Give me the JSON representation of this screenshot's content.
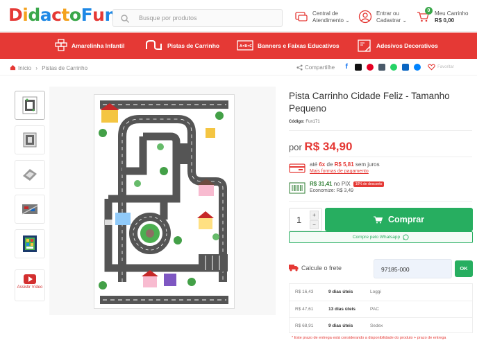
{
  "header": {
    "logo_parts": [
      {
        "text": "D",
        "color": "#e53935"
      },
      {
        "text": "i",
        "color": "#f4a21e"
      },
      {
        "text": "d",
        "color": "#3aa74a"
      },
      {
        "text": "a",
        "color": "#1e88e5"
      },
      {
        "text": "c",
        "color": "#e53935"
      },
      {
        "text": "t",
        "color": "#f4a21e"
      },
      {
        "text": "o",
        "color": "#3aa74a"
      },
      {
        "text": " F",
        "color": "#1e88e5"
      },
      {
        "text": "u",
        "color": "#e53935"
      },
      {
        "text": "n",
        "color": "#1e88e5"
      }
    ],
    "search_placeholder": "Busque por produtos",
    "support_line1": "Central de",
    "support_line2": "Atendimento ⌄",
    "login_line1": "Entrar ou",
    "login_line2": "Cadastrar ⌄",
    "cart_count": "0",
    "cart_line1": "Meu Carrinho",
    "cart_line2": "R$ 0,00"
  },
  "nav": [
    {
      "label": "Amarelinha Infantil",
      "icon": "hopscotch-icon"
    },
    {
      "label": "Pistas de Carrinho",
      "icon": "track-icon"
    },
    {
      "label": "Banners e Faixas Educativos",
      "icon": "banner-icon"
    },
    {
      "label": "Adesivos Decorativos",
      "icon": "sticker-icon"
    }
  ],
  "breadcrumb": {
    "home": "Início",
    "separator": "›",
    "current": "Pistas de Carrinho"
  },
  "share": {
    "label": "Compartilhe",
    "favorite": "Favoritar"
  },
  "product": {
    "title": "Pista Carrinho Cidade Feliz - Tamanho Pequeno",
    "code_label": "Código:",
    "code_value": "Fun171",
    "price_prefix": "por",
    "price": "R$ 34,90",
    "installments_prefix": "até",
    "installments_count": "6x",
    "installments_mid": "de",
    "installments_value": "R$ 5,81",
    "installments_suffix": "sem juros",
    "payment_link": "Mais formas de pagamento",
    "pix_price": "R$ 31,41",
    "pix_suffix": "no PIX",
    "pix_badge": "10% de desconto",
    "pix_savings": "Economize: R$ 3,49",
    "quantity": "1",
    "qty_up": "+",
    "qty_down": "−",
    "buy_label": "Comprar",
    "whatsapp_label": "Compre pelo Whatsapp"
  },
  "video_label": "Assistir Vídeo",
  "shipping": {
    "label": "Calcule o frete",
    "cep_value": "97185-000",
    "ok_label": "OK",
    "rows": [
      {
        "price": "R$ 16,43",
        "days": "9 dias úteis",
        "carrier": "Loggi"
      },
      {
        "price": "R$ 47,61",
        "days": "13 dias úteis",
        "carrier": "PAC"
      },
      {
        "price": "R$ 68,91",
        "days": "9 dias úteis",
        "carrier": "Sedex"
      }
    ],
    "note": "* Este prazo de entrega está considerando a disponibilidade do produto + prazo de entrega"
  },
  "colors": {
    "brand_red": "#e53935",
    "buy_green": "#27ae60",
    "price_red": "#e53935"
  }
}
